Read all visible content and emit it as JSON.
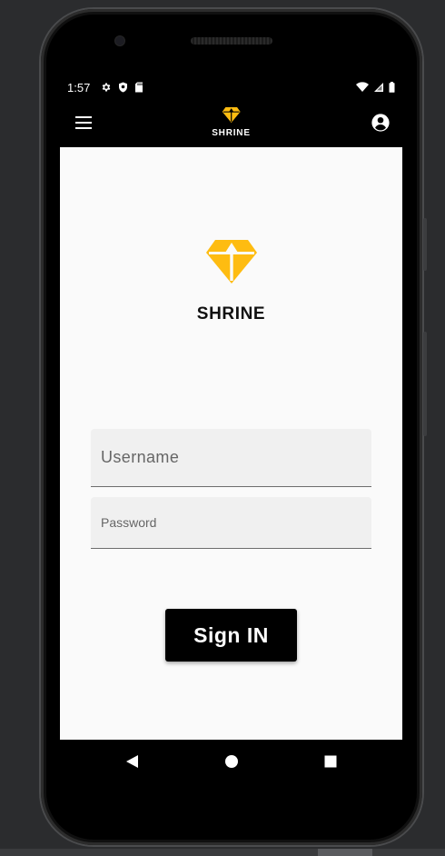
{
  "status_bar": {
    "time": "1:57",
    "left_icons": [
      "gear-icon",
      "shield-icon",
      "sd-card-icon"
    ],
    "right_icons": [
      "wifi-icon",
      "signal-icon",
      "battery-icon"
    ]
  },
  "app_bar": {
    "menu_icon": "menu-icon",
    "brand_icon": "diamond-icon",
    "brand_name": "SHRINE",
    "account_icon": "account-circle-icon"
  },
  "login": {
    "logo_icon": "diamond-icon",
    "logo_title": "SHRINE",
    "username": {
      "value": "",
      "placeholder": "Username"
    },
    "password": {
      "value": "",
      "placeholder": "Password"
    },
    "sign_in_label": "Sign IN"
  },
  "nav_bar": {
    "icons": [
      "back-icon",
      "home-icon",
      "recents-icon"
    ]
  },
  "colors": {
    "brand_accent": "#FEBC11",
    "app_bar_bg": "#000000",
    "screen_bg": "#FAFAFA",
    "field_bg": "#F0F0F0",
    "button_bg": "#000000",
    "button_text": "#FFFFFF"
  }
}
